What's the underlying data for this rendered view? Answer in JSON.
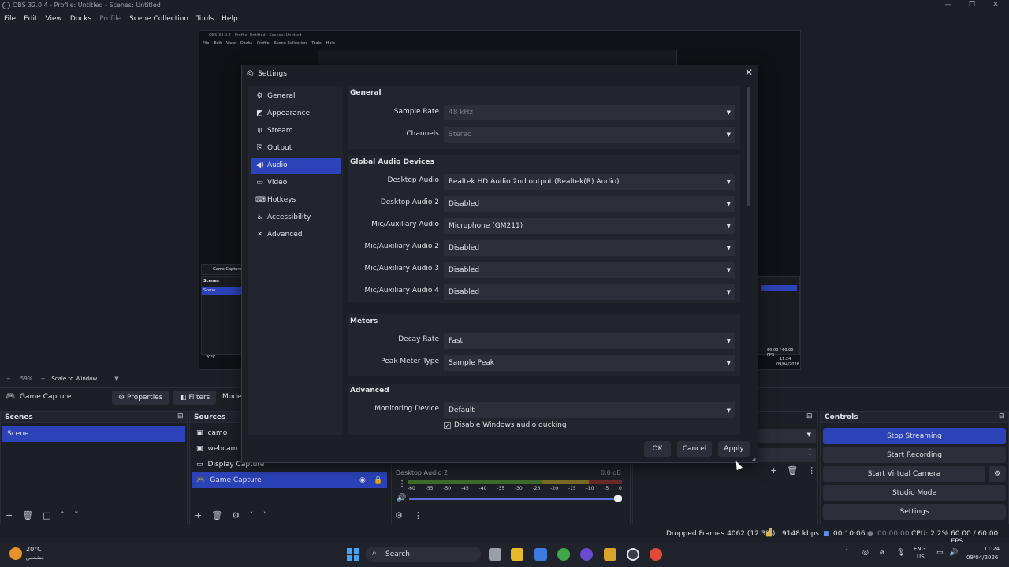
{
  "window": {
    "title": "OBS 32.0.4 - Profile: Untitled - Scenes: Untitled"
  },
  "menu": [
    "File",
    "Edit",
    "View",
    "Docks",
    "Profile",
    "Scene Collection",
    "Tools",
    "Help"
  ],
  "preview": {
    "inner_title": "OBS 32.0.4 - Profile: Untitled - Scenes: Untitled",
    "inner_menu": [
      "File",
      "Edit",
      "View",
      "Docks",
      "Profile",
      "Scene Collection",
      "Tools",
      "Help"
    ],
    "inner_source": "Game Capture",
    "inner_scenes": "Scenes",
    "inner_scene": "Scene",
    "inner_weather": "20°C",
    "inner_fps": "60.00 / 60.00 FPS",
    "inner_time": "11:24",
    "inner_date": "09/04/2026"
  },
  "zoombar": {
    "zoom": "59%",
    "mode": "Scale to Window"
  },
  "source_toolbar": {
    "source_name": "Game Capture",
    "properties": "Properties",
    "filters": "Filters",
    "mode": "Mode"
  },
  "scenes": {
    "title": "Scenes",
    "items": [
      "Scene"
    ]
  },
  "sources": {
    "title": "Sources",
    "items": [
      "camo",
      "webcam",
      "Display Capture",
      "Game Capture"
    ]
  },
  "mixer": {
    "track": "Desktop Audio 2",
    "level": "0.0 dB",
    "scale": [
      "-60",
      "-55",
      "-50",
      "-45",
      "-40",
      "-35",
      "-30",
      "-25",
      "-20",
      "-15",
      "-10",
      "-5",
      "0"
    ],
    "volume_fraction": 1.0
  },
  "controls": {
    "title": "Controls",
    "stop_streaming": "Stop Streaming",
    "start_recording": "Start Recording",
    "start_virtual_camera": "Start Virtual Camera",
    "studio_mode": "Studio Mode",
    "settings": "Settings"
  },
  "status": {
    "dropped": "Dropped Frames 4062 (12.3%)",
    "bitrate": "9148 kbps",
    "stream_time": "00:10:06",
    "rec_time": "00:00:00",
    "cpu": "CPU: 2.2%",
    "fps": "60.00 / 60.00 FPS"
  },
  "taskbar": {
    "temp": "20°C",
    "weather_desc": "مشمس",
    "search": "Search",
    "lang": "ENG",
    "region": "US",
    "time": "11:24",
    "date": "09/04/2026"
  },
  "settings": {
    "title": "Settings",
    "nav": [
      {
        "label": "General",
        "icon": "gear-icon"
      },
      {
        "label": "Appearance",
        "icon": "appearance-icon"
      },
      {
        "label": "Stream",
        "icon": "antenna-icon"
      },
      {
        "label": "Output",
        "icon": "output-icon"
      },
      {
        "label": "Audio",
        "icon": "speaker-icon"
      },
      {
        "label": "Video",
        "icon": "monitor-icon"
      },
      {
        "label": "Hotkeys",
        "icon": "keyboard-icon"
      },
      {
        "label": "Accessibility",
        "icon": "accessibility-icon"
      },
      {
        "label": "Advanced",
        "icon": "tools-icon"
      }
    ],
    "selected": "Audio",
    "general": {
      "title": "General",
      "sample_rate_label": "Sample Rate",
      "sample_rate": "48 kHz",
      "channels_label": "Channels",
      "channels": "Stereo"
    },
    "devices": {
      "title": "Global Audio Devices",
      "rows": [
        {
          "label": "Desktop Audio",
          "value": "Realtek HD Audio 2nd output (Realtek(R) Audio)"
        },
        {
          "label": "Desktop Audio 2",
          "value": "Disabled"
        },
        {
          "label": "Mic/Auxiliary Audio",
          "value": "Microphone (GM211)"
        },
        {
          "label": "Mic/Auxiliary Audio 2",
          "value": "Disabled"
        },
        {
          "label": "Mic/Auxiliary Audio 3",
          "value": "Disabled"
        },
        {
          "label": "Mic/Auxiliary Audio 4",
          "value": "Disabled"
        }
      ]
    },
    "meters": {
      "title": "Meters",
      "decay_label": "Decay Rate",
      "decay": "Fast",
      "peak_label": "Peak Meter Type",
      "peak": "Sample Peak"
    },
    "advanced": {
      "title": "Advanced",
      "monitoring_label": "Monitoring Device",
      "monitoring": "Default",
      "ducking": "Disable Windows audio ducking",
      "ducking_checked": true
    },
    "buttons": {
      "ok": "OK",
      "cancel": "Cancel",
      "apply": "Apply"
    }
  },
  "colors": {
    "accent": "#2c42b8",
    "background": "#1d1f26",
    "panel": "#22252d",
    "control": "#2c2f39"
  }
}
